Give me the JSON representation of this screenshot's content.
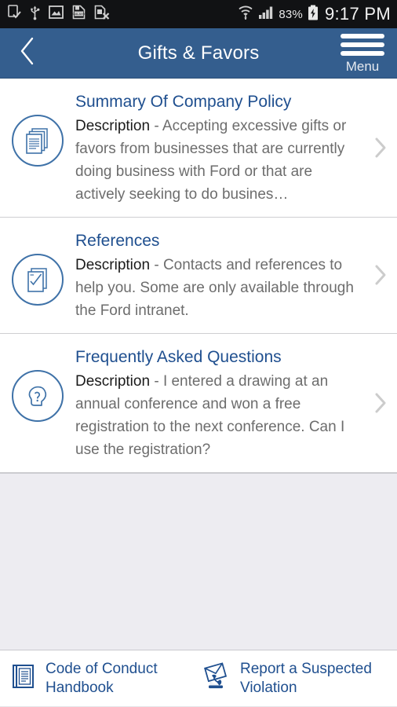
{
  "statusbar": {
    "icons_left": [
      "device-check-icon",
      "usb-icon",
      "photo-icon",
      "galaxy-app-icon",
      "sim-card-error-icon"
    ],
    "wifi_icon": "wifi-updown-icon",
    "signal_icon": "cellular-signal-icon",
    "battery_percent": "83%",
    "battery_icon": "battery-charging-icon",
    "clock": "9:17 PM"
  },
  "header": {
    "back_icon": "chevron-left-icon",
    "title": "Gifts & Favors",
    "menu_icon": "hamburger-menu-icon",
    "menu_label": "Menu",
    "background_color": "#345e8e"
  },
  "list": {
    "description_label": "Description",
    "separator": "-",
    "chevron_icon": "chevron-right-icon",
    "items": [
      {
        "icon": "documents-stack-icon",
        "title": "Summary Of Company Policy",
        "description": "Accepting excessive gifts or favors from businesses that are currently doing business with Ford or that are actively seeking to do busines…"
      },
      {
        "icon": "checklist-document-icon",
        "title": "References",
        "description": "Contacts and references to help you. Some are only available through the Ford intranet."
      },
      {
        "icon": "head-question-icon",
        "title": "Frequently Asked Questions",
        "description": "I entered a drawing at an annual conference and won a free registration to the next conference. Can I use the registration?"
      }
    ]
  },
  "bottombar": {
    "items": [
      {
        "icon": "book-icon",
        "label": "Code of Conduct Handbook"
      },
      {
        "icon": "report-envelope-phone-icon",
        "label": "Report a Suspected Violation"
      }
    ]
  },
  "colors": {
    "header_blue": "#345e8e",
    "title_blue": "#1f4f8f",
    "icon_blue": "#3f72a8",
    "body_gray": "#6d6d6d",
    "filler_gray": "#edecf1"
  }
}
